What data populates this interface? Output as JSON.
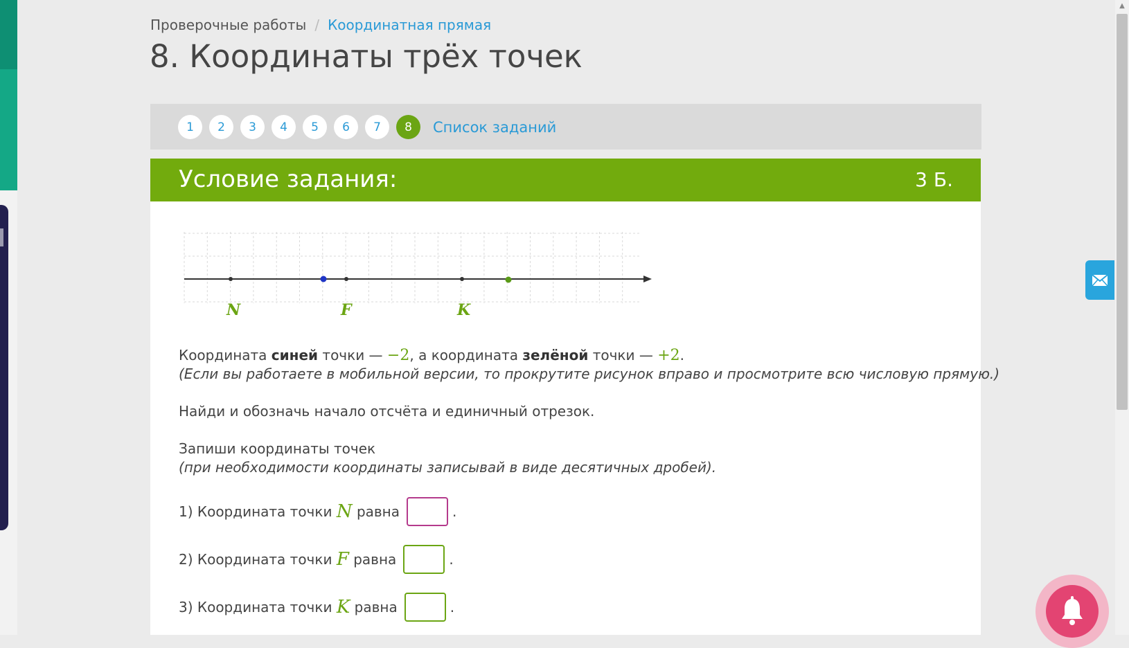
{
  "breadcrumb": {
    "parent": "Проверочные работы",
    "separator": "/",
    "current": "Координатная прямая"
  },
  "page_title": "8. Координаты трёх точек",
  "task_nav": {
    "numbers": [
      "1",
      "2",
      "3",
      "4",
      "5",
      "6",
      "7",
      "8"
    ],
    "active": "8",
    "list_link": "Список заданий"
  },
  "condition": {
    "title": "Условие задания:",
    "points": "3 Б."
  },
  "number_line": {
    "labels": [
      "N",
      "F",
      "K"
    ],
    "colors": {
      "axis": "#333333",
      "grid": "#d6d6d6",
      "blue_point": "#1f35c6",
      "green_point": "#5a9a17",
      "labels": "#6ba513"
    }
  },
  "text": {
    "line1_a": "Координата ",
    "line1_blue": "синей",
    "line1_b": " точки — ",
    "line1_val1": "−2",
    "line1_c": ", а координата ",
    "line1_green": "зелёной",
    "line1_d": " точки — ",
    "line1_val2": "+2",
    "line1_e": ".",
    "mobile_note": "(Если вы работаете в мобильной версии, то прокрутите рисунок вправо и просмотрите всю числовую прямую.)",
    "instruction": "Найди и обозначь начало отсчёта и единичный отрезок.",
    "write_coords": "Запиши координаты точек",
    "decimal_note": "(при необходимости координаты записывай в виде десятичных дробей)."
  },
  "answers": [
    {
      "prefix": "1) Координата точки ",
      "letter": "N",
      "suffix": " равна",
      "value": "",
      "end": "."
    },
    {
      "prefix": "2) Координата точки ",
      "letter": "F",
      "suffix": " равна",
      "value": "",
      "end": "."
    },
    {
      "prefix": "3) Координата точки ",
      "letter": "K",
      "suffix": " равна",
      "value": "",
      "end": "."
    }
  ],
  "icons": {
    "mail": "envelope-icon",
    "bell": "bell-icon"
  }
}
